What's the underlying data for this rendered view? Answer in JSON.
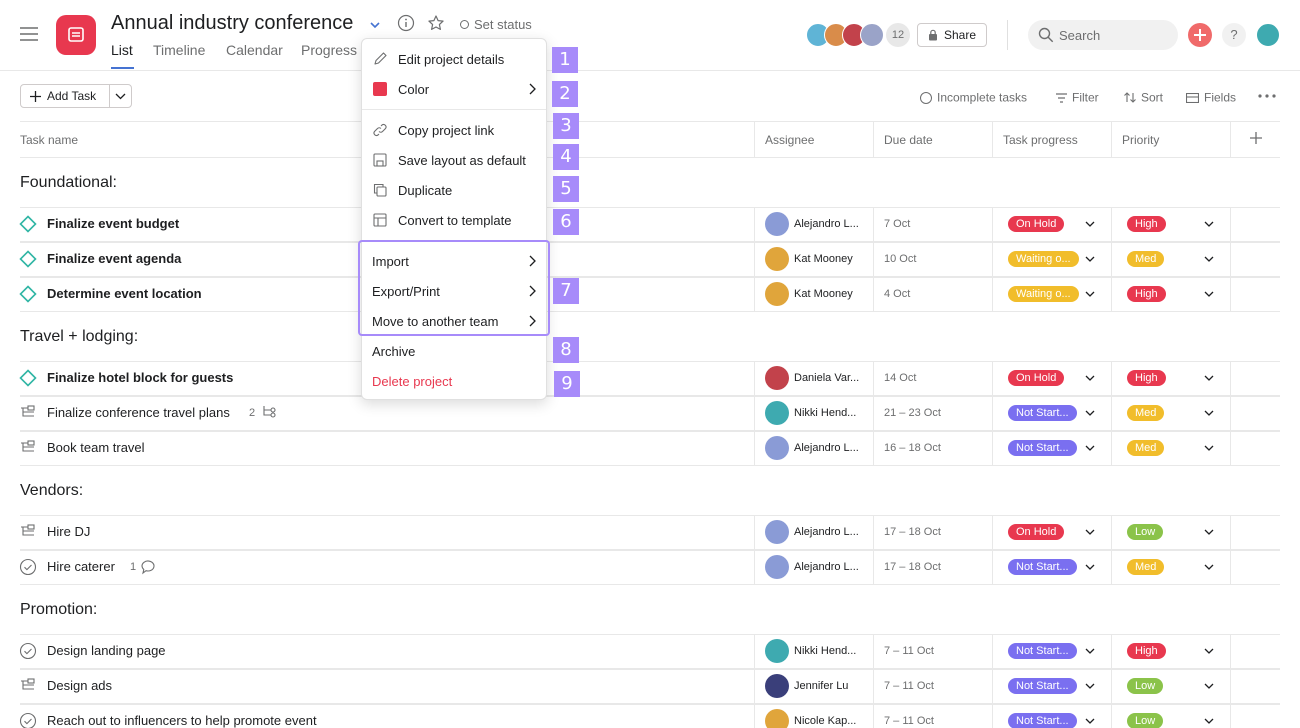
{
  "header": {
    "title": "Annual industry conference",
    "set_status": "Set status",
    "tabs": [
      "List",
      "Timeline",
      "Calendar",
      "Progress"
    ],
    "member_count": "12",
    "share": "Share",
    "search_placeholder": "Search",
    "help": "?"
  },
  "toolbar": {
    "add_task": "Add Task",
    "incomplete": "Incomplete tasks",
    "filter": "Filter",
    "sort": "Sort",
    "fields": "Fields"
  },
  "columns": {
    "task_name": "Task name",
    "assignee": "Assignee",
    "due_date": "Due date",
    "progress": "Task progress",
    "priority": "Priority"
  },
  "sections": [
    {
      "name": "Foundational:"
    },
    {
      "name": "Travel + lodging:"
    },
    {
      "name": "Vendors:"
    },
    {
      "name": "Promotion:"
    }
  ],
  "tasks": [
    {
      "name": "Finalize event budget",
      "assignee": "Alejandro L...",
      "due": "7 Oct",
      "progress": "On Hold",
      "priority": "High"
    },
    {
      "name": "Finalize event agenda",
      "assignee": "Kat Mooney",
      "due": "10 Oct",
      "progress": "Waiting o...",
      "priority": "Med"
    },
    {
      "name": "Determine event location",
      "assignee": "Kat Mooney",
      "due": "4 Oct",
      "progress": "Waiting o...",
      "priority": "High"
    },
    {
      "name": "Finalize hotel block for guests",
      "assignee": "Daniela Var...",
      "due": "14 Oct",
      "progress": "On Hold",
      "priority": "High"
    },
    {
      "name": "Finalize conference travel plans",
      "assignee": "Nikki Hend...",
      "due": "21 – 23 Oct",
      "progress": "Not Start...",
      "priority": "Med",
      "subtasks": "2"
    },
    {
      "name": "Book team travel",
      "assignee": "Alejandro L...",
      "due": "16 – 18 Oct",
      "progress": "Not Start...",
      "priority": "Med"
    },
    {
      "name": "Hire DJ",
      "assignee": "Alejandro L...",
      "due": "17 – 18 Oct",
      "progress": "On Hold",
      "priority": "Low"
    },
    {
      "name": "Hire caterer",
      "assignee": "Alejandro L...",
      "due": "17 – 18 Oct",
      "progress": "Not Start...",
      "priority": "Med",
      "comments": "1"
    },
    {
      "name": "Design landing page",
      "assignee": "Nikki Hend...",
      "due": "7 – 11 Oct",
      "progress": "Not Start...",
      "priority": "High"
    },
    {
      "name": "Design ads",
      "assignee": "Jennifer Lu",
      "due": "7 – 11 Oct",
      "progress": "Not Start...",
      "priority": "Low"
    },
    {
      "name": "Reach out to influencers to help promote event",
      "assignee": "Nicole Kap...",
      "due": "7 – 11 Oct",
      "progress": "Not Start...",
      "priority": "Low"
    }
  ],
  "menu": {
    "items": [
      "Edit project details",
      "Color",
      "Copy project link",
      "Save layout as default",
      "Duplicate",
      "Convert to template",
      "Import",
      "Export/Print",
      "Move to another team",
      "Archive",
      "Delete project"
    ],
    "badges": [
      "1",
      "2",
      "3",
      "4",
      "5",
      "6",
      "7",
      "8",
      "9"
    ]
  },
  "colors": {
    "on_hold": "#e8384f",
    "waiting": "#f1bd2b",
    "not_started": "#7a6ff0",
    "high": "#e8384f",
    "med": "#f1bd2b",
    "low": "#8bc34a",
    "project_icon": "#e8384f",
    "accent_blue": "#4573d2"
  }
}
